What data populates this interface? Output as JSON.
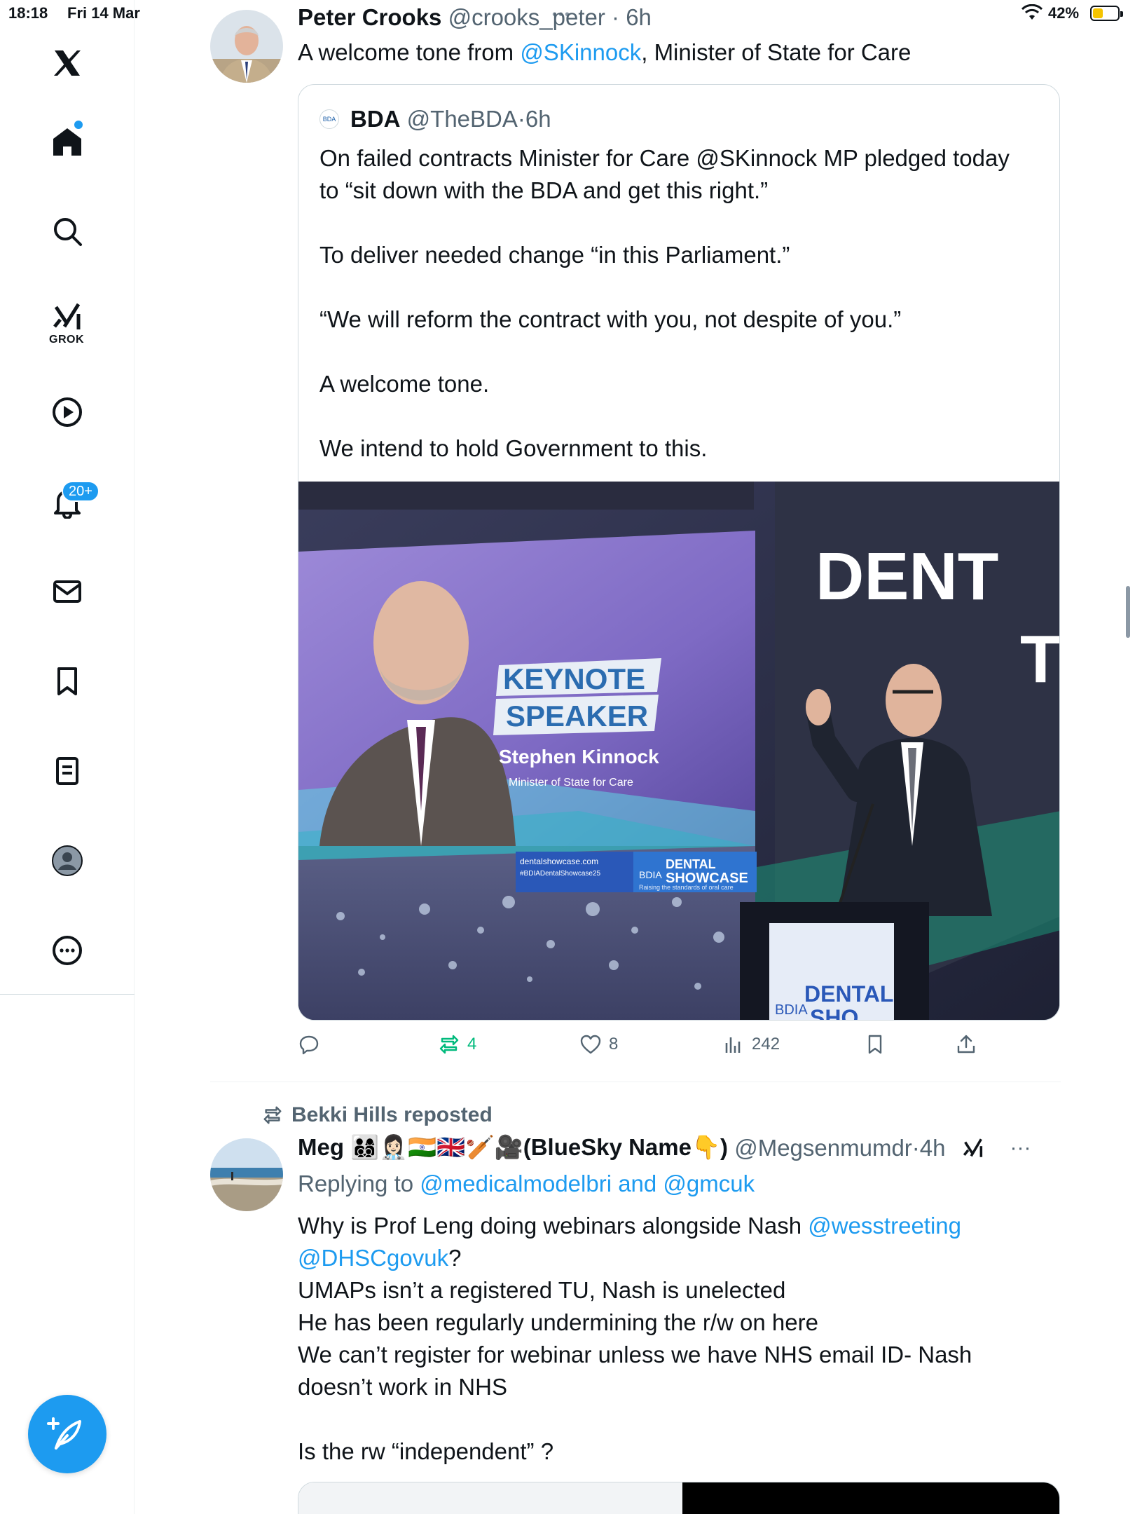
{
  "status_bar": {
    "time": "18:18",
    "date": "Fri 14 Mar",
    "battery_percent": "42%",
    "battery_level": 0.42
  },
  "sidebar": {
    "items": [
      {
        "name": "x-logo",
        "icon": "x-logo-icon"
      },
      {
        "name": "home",
        "icon": "home-icon",
        "has_dot": true
      },
      {
        "name": "search",
        "icon": "search-icon"
      },
      {
        "name": "grok",
        "icon": "grok-icon",
        "label": "GROK"
      },
      {
        "name": "video",
        "icon": "play-icon"
      },
      {
        "name": "notifications",
        "icon": "bell-icon",
        "badge": "20+"
      },
      {
        "name": "messages",
        "icon": "mail-icon"
      },
      {
        "name": "bookmarks",
        "icon": "bookmark-icon"
      },
      {
        "name": "lists",
        "icon": "list-icon"
      },
      {
        "name": "profile",
        "icon": "profile-icon"
      },
      {
        "name": "more",
        "icon": "more-icon"
      }
    ],
    "compose_icon": "compose-icon"
  },
  "tweet1": {
    "author_name": "Peter Crooks",
    "handle": "@crooks_peter",
    "time": "6h",
    "text_before": "A welcome tone from ",
    "mention": "@SKinnock",
    "text_after": ", Minister of State for Care",
    "quote": {
      "logo": "BDA",
      "author_name": "BDA",
      "handle": "@TheBDA",
      "time": "6h",
      "lines": [
        "On failed contracts Minister for Care @SKinnock MP pledged today",
        "to “sit down with the BDA and get this right.”",
        "",
        "To deliver needed change “in this Parliament.”",
        "",
        "“We will reform the contract with you, not despite of you.”",
        "",
        "A welcome tone.",
        "",
        "We intend to hold Government to this."
      ],
      "image": {
        "keynote_line1": "KEYNOTE",
        "keynote_line2": "SPEAKER",
        "speaker_name": "Stephen Kinnock",
        "speaker_role": "Minister of State for Care",
        "website": "dentalshowcase.com",
        "hashtag": "#BDIADentalShowcase25",
        "brand_small": "BDIA",
        "brand_dental": "DENTAL",
        "brand_showcase": "SHOWCASE",
        "brand_tagline": "Raising the standards of oral care",
        "wall_text_1": "DENT",
        "wall_text_2": "T",
        "podium_brand": "BDIA",
        "podium_dental": "DENTAL",
        "podium_showcase": "SHO"
      }
    },
    "actions": {
      "reply_count": "",
      "repost_count": "4",
      "like_count": "8",
      "views_count": "242"
    }
  },
  "tweet2": {
    "reposted_by": "Bekki Hills reposted",
    "author_name": "Meg 👨‍👩‍👦‍👦👩🏻‍⚕️🇮🇳🇬🇧🏏🎥(BlueSky Name👇)",
    "handle": "@Megsenmumdr",
    "time": "4h",
    "reply_prefix": "Replying to ",
    "reply_to": "@medicalmodelbri and @gmcuk",
    "body_line1_text": "Why is Prof Leng doing webinars alongside Nash ",
    "body_line1_mention": "@wesstreeting",
    "body_line2_mention": "@DHSCgovuk",
    "body_line2_text": "?",
    "body_lines": [
      "UMAPs isn’t a registered TU, Nash is unelected",
      "He has been regularly undermining the r/w on here",
      "We can’t register for webinar unless we have NHS email ID- Nash",
      "doesn’t work in NHS",
      "",
      "Is the rw “independent” ?"
    ]
  }
}
